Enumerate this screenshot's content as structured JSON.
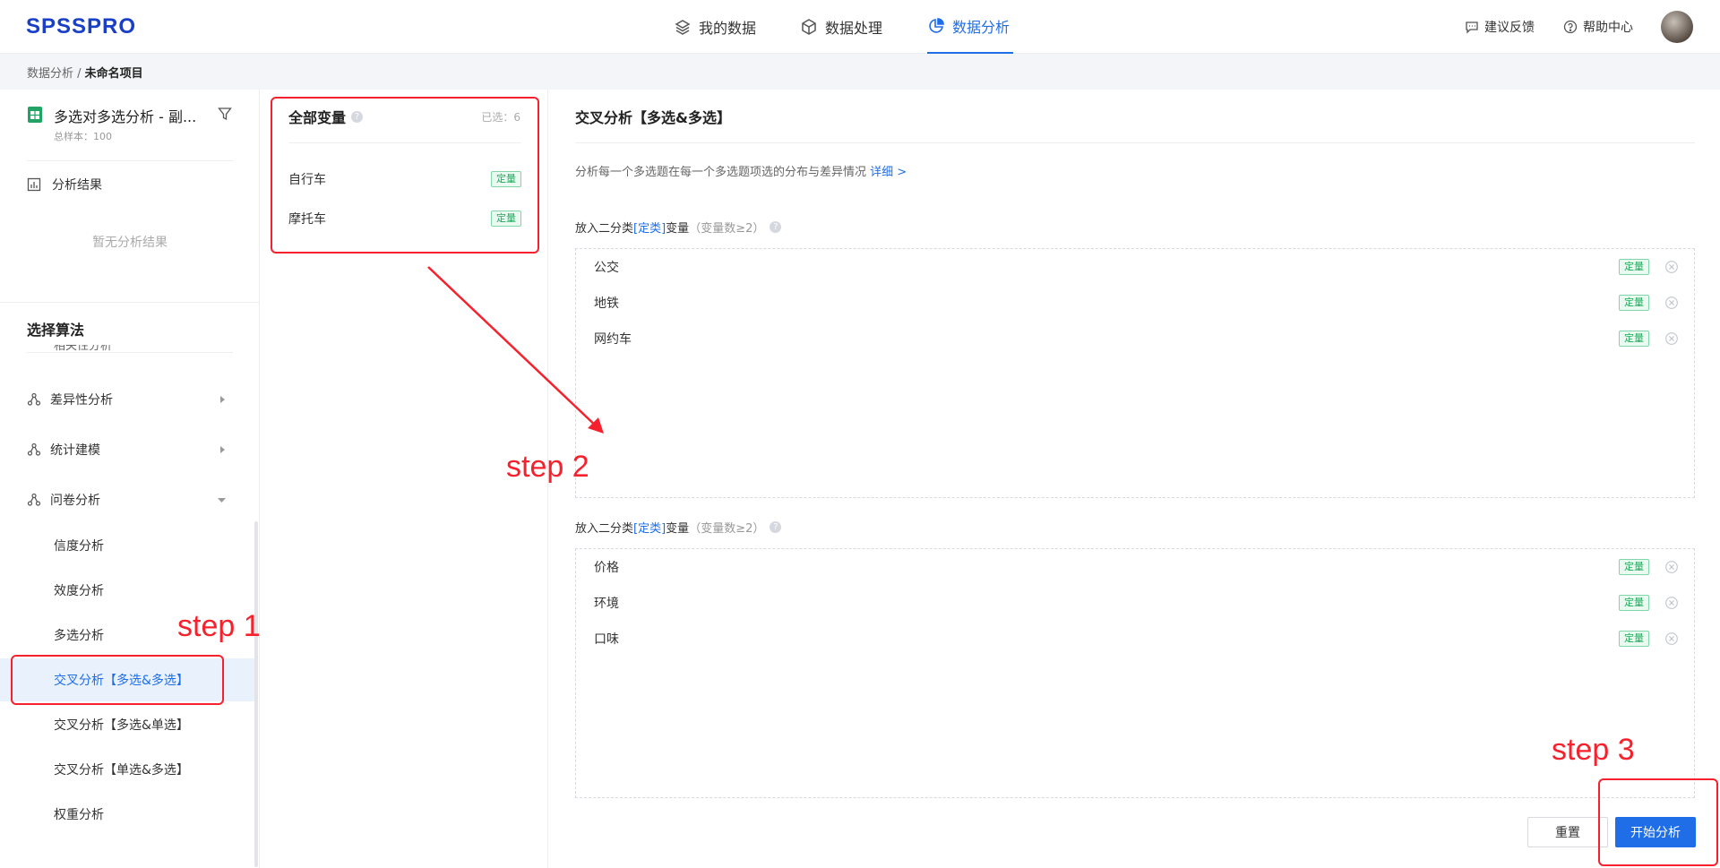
{
  "app": {
    "logo": "SPSSPRO"
  },
  "nav": {
    "items": [
      {
        "label": "我的数据",
        "icon": "layers-icon"
      },
      {
        "label": "数据处理",
        "icon": "cube-icon"
      },
      {
        "label": "数据分析",
        "icon": "pie-chart-icon",
        "active": true
      }
    ]
  },
  "header_right": {
    "feedback": "建议反馈",
    "help": "帮助中心"
  },
  "breadcrumb": {
    "parent": "数据分析 /",
    "current": "未命名项目"
  },
  "dataset": {
    "title": "多选对多选分析 - 副...",
    "sample": "总样本：100"
  },
  "results": {
    "label": "分析结果",
    "empty": "暂无分析结果"
  },
  "algorithms": {
    "heading": "选择算法",
    "cut_item": "相关性分析",
    "groups": [
      {
        "label": "差异性分析",
        "expanded": false
      },
      {
        "label": "统计建模",
        "expanded": false
      },
      {
        "label": "问卷分析",
        "expanded": true
      }
    ],
    "subitems": [
      {
        "label": "信度分析"
      },
      {
        "label": "效度分析"
      },
      {
        "label": "多选分析"
      },
      {
        "label": "交叉分析【多选&多选】",
        "active": true
      },
      {
        "label": "交叉分析【多选&单选】"
      },
      {
        "label": "交叉分析【单选&多选】"
      },
      {
        "label": "权重分析"
      }
    ]
  },
  "variables": {
    "title": "全部变量",
    "selected": "已选：6",
    "items": [
      {
        "name": "自行车",
        "tag": "定量"
      },
      {
        "name": "摩托车",
        "tag": "定量"
      }
    ]
  },
  "panel": {
    "title": "交叉分析【多选&多选】",
    "desc": "分析每一个多选题在每一个多选题项选的分布与差异情况",
    "detail_link": "详细 >",
    "zones": [
      {
        "label_prefix": "放入二分类",
        "label_type": "[定类]",
        "label_suffix": "变量",
        "label_hint": "（变量数≥2）",
        "items": [
          {
            "name": "公交",
            "tag": "定量"
          },
          {
            "name": "地铁",
            "tag": "定量"
          },
          {
            "name": "网约车",
            "tag": "定量"
          }
        ]
      },
      {
        "label_prefix": "放入二分类",
        "label_type": "[定类]",
        "label_suffix": "变量",
        "label_hint": "（变量数≥2）",
        "items": [
          {
            "name": "价格",
            "tag": "定量"
          },
          {
            "name": "环境",
            "tag": "定量"
          },
          {
            "name": "口味",
            "tag": "定量"
          }
        ]
      }
    ],
    "reset_label": "重置",
    "start_label": "开始分析"
  },
  "annotations": {
    "step1": "step 1",
    "step2": "step 2",
    "step3": "step 3"
  },
  "colors": {
    "accent": "#1f6ee8",
    "annotation": "#f5222d",
    "tag_green": "#1fa95b"
  }
}
